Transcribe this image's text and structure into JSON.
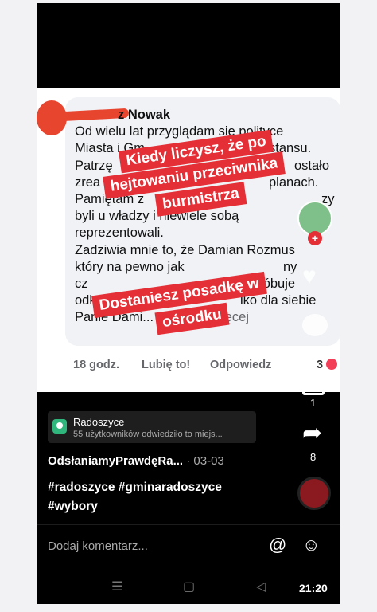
{
  "comment": {
    "author_visible": "z Nowak",
    "lines": [
      "Od wielu lat przyglądam się polityce",
      "Miasta i Gm",
      "Patrzę",
      "zrea",
      "Pamiętam z",
      "byli u władzy i niewiele sobą",
      "reprezentowali.",
      "Zadziwia mnie to, że Damian Rozmus",
      "który na pewno jak",
      "cz",
      "odkroić kaw",
      "Panie Dami..."
    ],
    "see_more": "Wyświetl więcej",
    "time": "18 godz.",
    "like": "Lubię to!",
    "reply": "Odpowiedz",
    "reactions": "3"
  },
  "sticker1": {
    "lines": [
      "Kiedy liczysz, że po",
      "hejtowaniu przeciwnika",
      "burmistrza"
    ]
  },
  "sticker2": {
    "lines": [
      "Dostaniesz posadkę w",
      "ośrodku"
    ]
  },
  "partial_text": {
    "p1": "stansu.",
    "p2": "ostało",
    "p3": "planach.",
    "p4": "zy",
    "p5": "ny",
    "p6": "co ja, próbuje",
    "p7": "lko dla siebie"
  },
  "side": {
    "comments_count": "1",
    "share_count": "8"
  },
  "location": {
    "name": "Radoszyce",
    "sub": "55 użytkowników odwiedziło to miejs..."
  },
  "post": {
    "author": "OdsłaniamyPrawdęRa...",
    "date": "· 03-03",
    "tags_line1": "#radoszyce #gminaradoszyce",
    "tags_line2": "#wybory"
  },
  "comment_input": {
    "placeholder": "Dodaj komentarz..."
  },
  "status": {
    "time": "21:20"
  },
  "colors": {
    "sticker": "#e42f37",
    "scribble": "#e8452f",
    "pin": "#2fb67c"
  }
}
